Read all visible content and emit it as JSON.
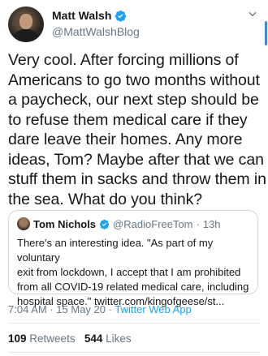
{
  "author": {
    "name": "Matt Walsh",
    "handle": "@MattWalshBlog"
  },
  "tweet": {
    "text": "Very cool. After forcing millions of\nAmericans to go two months without\na paycheck, our next step should be\nto refuse them medical care if they\ndare leave their homes. Any more\nideas, Tom? Maybe after that we can\nstuff them in sacks and throw them in\nthe sea. What do you think?"
  },
  "quote": {
    "name": "Tom Nichols",
    "handle": "@RadioFreeTom",
    "separator": "·",
    "time": "13h",
    "text": "There's an interesting idea. \"As part of my voluntary\nexit from lockdown, I accept that I am prohibited\nfrom all COVID-19 related medical care, including\nhospital space.\" twitter.com/kingofgeese/st..."
  },
  "meta": {
    "time": "7:04 AM",
    "sep1": "·",
    "date": "15 May 20",
    "sep2": "·",
    "app": "Twitter Web App"
  },
  "stats": {
    "retweets": "109",
    "retweets_label": "Retweets",
    "likes": "544",
    "likes_label": "Likes"
  },
  "colors": {
    "accent": "#1da1f2",
    "muted": "#657786",
    "text": "#14171a",
    "border": "#ccd6dd"
  },
  "icons": {
    "verified": "verified-badge-icon",
    "menu": "chevron-down-icon"
  }
}
